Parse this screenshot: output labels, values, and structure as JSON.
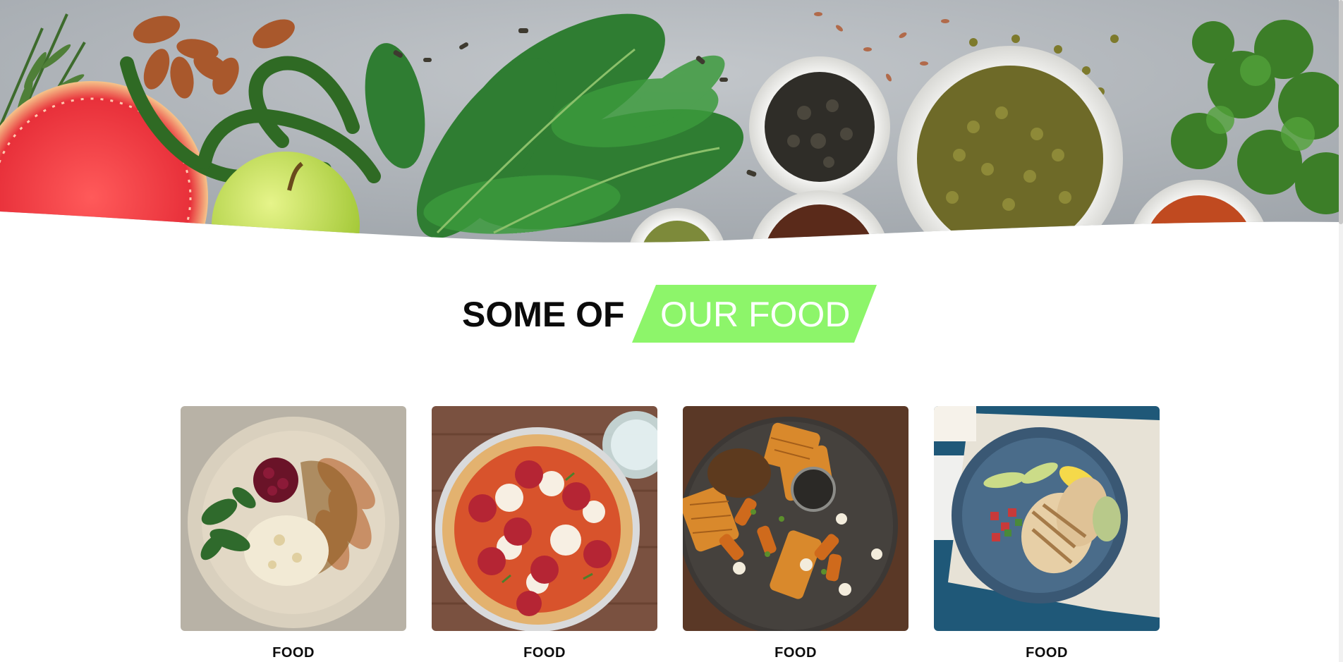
{
  "hero": {
    "image": "fresh-vegetables-spices-banner"
  },
  "heading": {
    "part1": "SOME OF",
    "part2": "OUR FOOD",
    "accent_color": "#8df56a"
  },
  "food_items": [
    {
      "label": "FOOD",
      "image": "roast-turkey-mashed-potato-plate"
    },
    {
      "label": "FOOD",
      "image": "pepperoni-pizza"
    },
    {
      "label": "FOOD",
      "image": "waffles-sweet-potato-plate"
    },
    {
      "label": "FOOD",
      "image": "grilled-chicken-salad-bowl"
    }
  ]
}
